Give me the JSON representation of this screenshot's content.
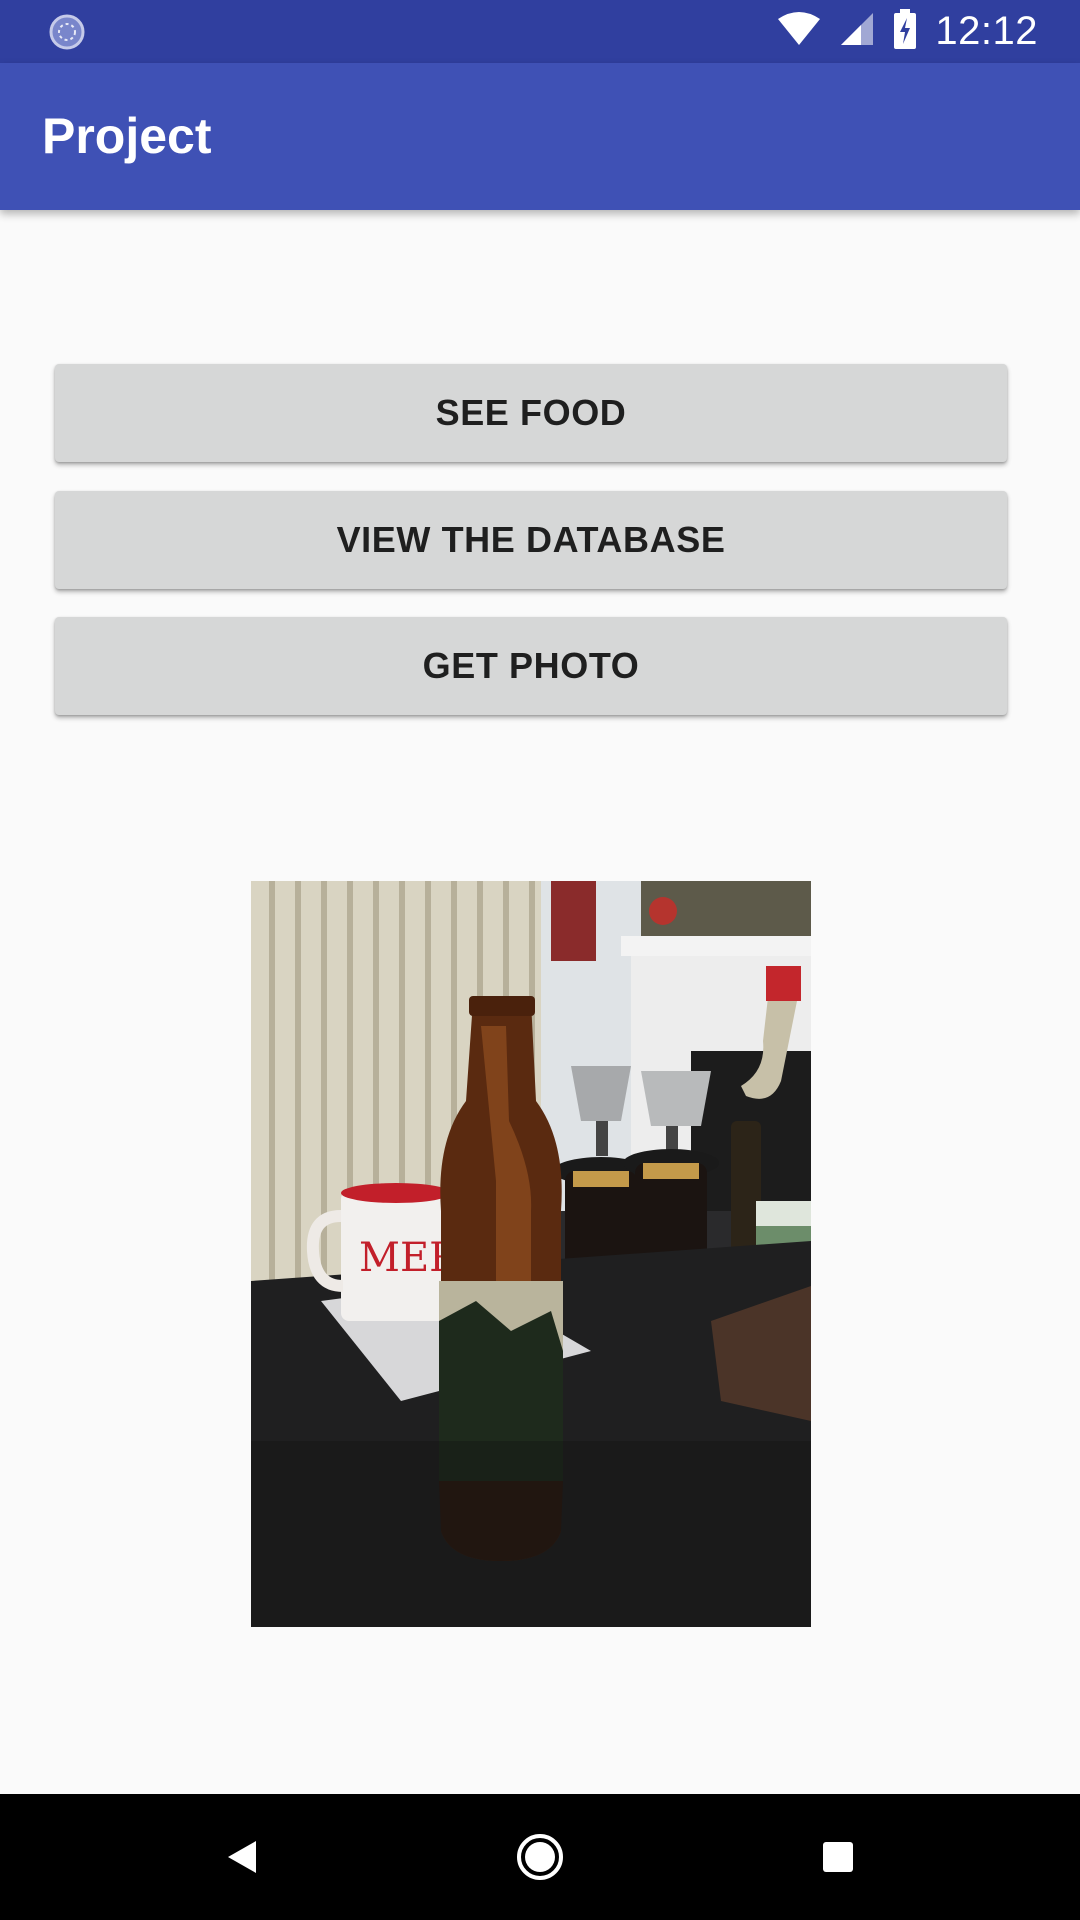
{
  "status_bar": {
    "time": "12:12",
    "icons": [
      "sync-icon",
      "wifi-icon",
      "signal-icon",
      "battery-charging-icon"
    ]
  },
  "app_bar": {
    "title": "Project"
  },
  "buttons": {
    "see_food": "SEE FOOD",
    "view_database": "VIEW THE DATABASE",
    "get_photo": "GET PHOTO"
  },
  "photo": {
    "mug_text": "MERRY"
  },
  "nav_bar": {
    "icons": [
      "back-icon",
      "home-icon",
      "recents-icon"
    ]
  },
  "colors": {
    "primary": "#3f51b5",
    "primary_dark": "#303f9f",
    "button": "#d6d7d7",
    "background": "#fafafa"
  }
}
